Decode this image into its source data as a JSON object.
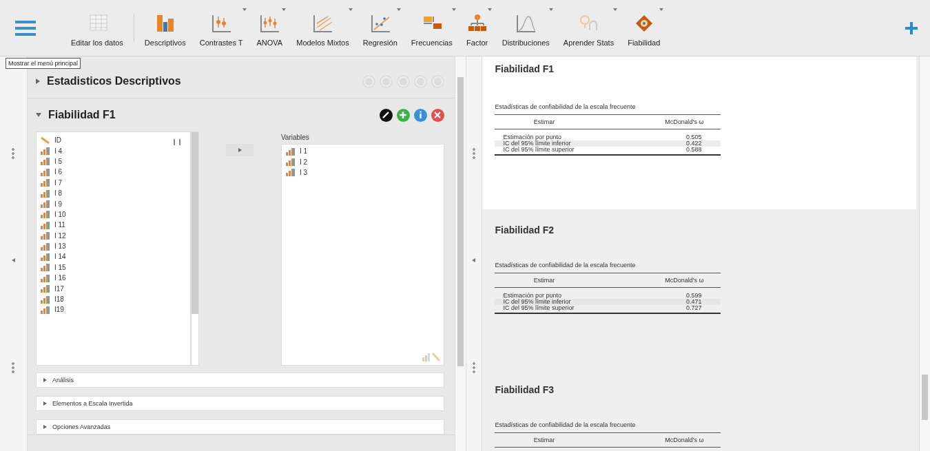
{
  "toolbar": {
    "menu_tooltip": "Mostrar el menú principal",
    "items": [
      {
        "label": "Editar los datos",
        "kind": "data",
        "dropdown": false
      },
      {
        "label": "Descriptivos",
        "kind": "descriptives",
        "dropdown": false
      },
      {
        "label": "Contrastes T",
        "kind": "ttest",
        "dropdown": true
      },
      {
        "label": "ANOVA",
        "kind": "anova",
        "dropdown": true
      },
      {
        "label": "Modelos Mixtos",
        "kind": "mixed",
        "dropdown": true
      },
      {
        "label": "Regresión",
        "kind": "regression",
        "dropdown": true
      },
      {
        "label": "Frecuencias",
        "kind": "frequencies",
        "dropdown": true
      },
      {
        "label": "Factor",
        "kind": "factor",
        "dropdown": true
      },
      {
        "label": "Distribuciones",
        "kind": "distributions",
        "dropdown": true
      },
      {
        "label": "Aprender Stats",
        "kind": "learn",
        "dropdown": true
      },
      {
        "label": "Fiabilidad",
        "kind": "reliability",
        "dropdown": true
      }
    ]
  },
  "analyses": [
    {
      "title": "Estadisticos Descriptivos",
      "expanded": false,
      "active": false
    },
    {
      "title": "Fiabilidad F1",
      "expanded": true,
      "active": true,
      "available_variables": [
        {
          "name": "ID",
          "kind": "nominal"
        },
        {
          "name": "I 4",
          "kind": "ordinal"
        },
        {
          "name": "I 5",
          "kind": "ordinal"
        },
        {
          "name": "I 6",
          "kind": "ordinal"
        },
        {
          "name": "I 7",
          "kind": "ordinal"
        },
        {
          "name": "I 8",
          "kind": "ordinal"
        },
        {
          "name": "I 9",
          "kind": "ordinal"
        },
        {
          "name": "I 10",
          "kind": "ordinal"
        },
        {
          "name": "I 11",
          "kind": "ordinal"
        },
        {
          "name": "I 12",
          "kind": "ordinal"
        },
        {
          "name": "I 13",
          "kind": "ordinal"
        },
        {
          "name": "I 14",
          "kind": "ordinal"
        },
        {
          "name": "I 15",
          "kind": "ordinal"
        },
        {
          "name": "I 16",
          "kind": "ordinal"
        },
        {
          "name": "I17",
          "kind": "ordinal"
        },
        {
          "name": "I18",
          "kind": "ordinal"
        },
        {
          "name": "I19",
          "kind": "ordinal"
        }
      ],
      "variables_label": "Variables",
      "variables": [
        {
          "name": "I 1",
          "kind": "ordinal"
        },
        {
          "name": "I 2",
          "kind": "ordinal"
        },
        {
          "name": "I 3",
          "kind": "ordinal"
        }
      ],
      "sections": [
        {
          "title": "Análisis",
          "expanded": false
        },
        {
          "title": "Elementos a Escala Invertida",
          "expanded": false
        },
        {
          "title": "Opciones Avanzadas",
          "expanded": false
        }
      ]
    }
  ],
  "results": [
    {
      "title": "Fiabilidad F1",
      "selected": true,
      "table": {
        "caption": "Estadísticas de confiabilidad de la escala frecuente",
        "columns": [
          "Estimar",
          "McDonald's ω"
        ],
        "rows": [
          [
            "Estimación por punto",
            "0.505"
          ],
          [
            "IC del 95% límite inferior",
            "0.422"
          ],
          [
            "IC del 95% límite superior",
            "0.588"
          ]
        ]
      }
    },
    {
      "title": "Fiabilidad F2",
      "selected": false,
      "table": {
        "caption": "Estadísticas de confiabilidad de la escala frecuente",
        "columns": [
          "Estimar",
          "McDonald's ω"
        ],
        "rows": [
          [
            "Estimación por punto",
            "0.599"
          ],
          [
            "IC del 95% límite inferior",
            "0.471"
          ],
          [
            "IC del 95% límite superior",
            "0.727"
          ]
        ]
      }
    },
    {
      "title": "Fiabilidad F3",
      "selected": false,
      "table": {
        "caption": "Estadísticas de confiabilidad de la escala frecuente",
        "columns": [
          "Estimar",
          "McDonald's ω"
        ]
      }
    }
  ]
}
